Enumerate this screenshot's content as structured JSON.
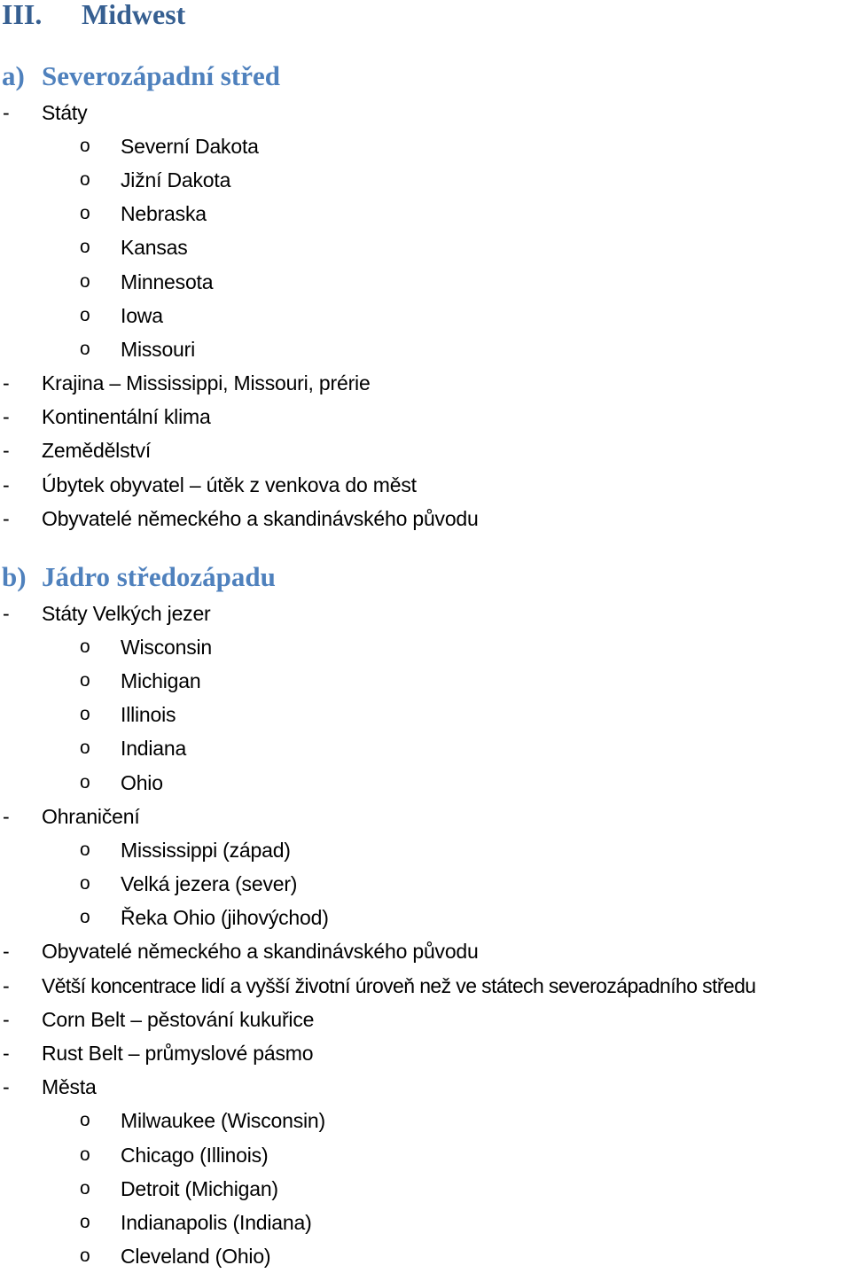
{
  "document": {
    "chapter": {
      "number": "III.",
      "title": "Midwest"
    },
    "sections": [
      {
        "marker": "a)",
        "title": "Severozápadní střed",
        "items": [
          {
            "text": "Státy",
            "children": [
              "Severní Dakota",
              "Jižní Dakota",
              "Nebraska",
              "Kansas",
              "Minnesota",
              "Iowa",
              "Missouri"
            ]
          },
          {
            "text": "Krajina – Mississippi, Missouri, prérie"
          },
          {
            "text": "Kontinentální klima"
          },
          {
            "text": "Zemědělství"
          },
          {
            "text": "Úbytek obyvatel – útěk z venkova do měst"
          },
          {
            "text": "Obyvatelé německého a skandinávského původu"
          }
        ]
      },
      {
        "marker": "b)",
        "title": "Jádro středozápadu",
        "items": [
          {
            "text": "Státy Velkých jezer",
            "children": [
              "Wisconsin",
              "Michigan",
              "Illinois",
              "Indiana",
              "Ohio"
            ]
          },
          {
            "text": "Ohraničení",
            "children": [
              "Mississippi (západ)",
              "Velká jezera (sever)",
              "Řeka Ohio (jihovýchod)"
            ]
          },
          {
            "text": "Obyvatelé německého a skandinávského původu"
          },
          {
            "text": "Větší koncentrace lidí a vyšší životní úroveň než ve státech severozápadního středu"
          },
          {
            "text": "Corn Belt – pěstování kukuřice"
          },
          {
            "text": "Rust Belt – průmyslové pásmo"
          },
          {
            "text": "Města",
            "children": [
              "Milwaukee (Wisconsin)",
              "Chicago (Illinois)",
              "Detroit (Michigan)",
              "Indianapolis (Indiana)",
              "Cleveland (Ohio)"
            ]
          }
        ]
      }
    ]
  },
  "glyphs": {
    "dash": "-",
    "bullet": "o"
  },
  "colors": {
    "chapter_heading": "#365f91",
    "section_heading": "#4f81bd",
    "body_text": "#000000"
  }
}
